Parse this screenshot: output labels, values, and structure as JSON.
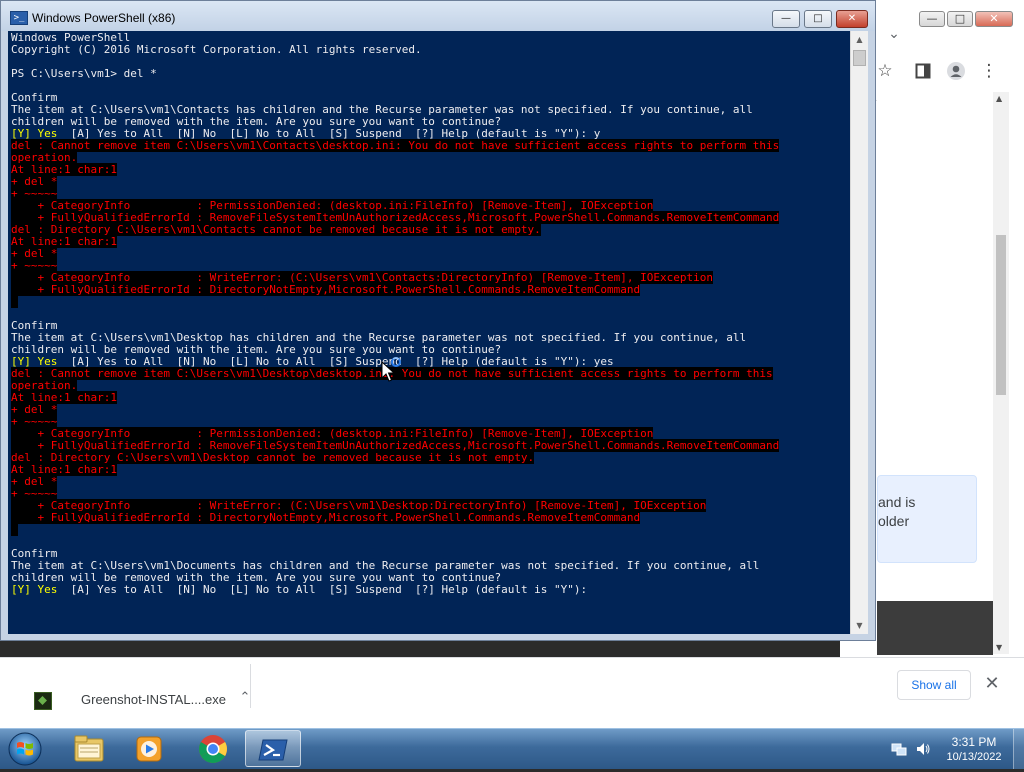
{
  "powershell": {
    "title": "Windows PowerShell (x86)",
    "icon_glyph": ">_",
    "buttons": {
      "minimize": "—",
      "maximize": "□",
      "close": "✕"
    },
    "lines": [
      {
        "t": "Windows PowerShell",
        "s": "normal"
      },
      {
        "t": "Copyright (C) 2016 Microsoft Corporation. All rights reserved.",
        "s": "normal"
      },
      {
        "t": "",
        "s": "normal"
      },
      {
        "t": "PS C:\\Users\\vm1> del *",
        "s": "normal"
      },
      {
        "t": "",
        "s": "normal"
      },
      {
        "t": "Confirm",
        "s": "normal"
      },
      {
        "t": "The item at C:\\Users\\vm1\\Contacts has children and the Recurse parameter was not specified. If you continue, all",
        "s": "normal"
      },
      {
        "t": "children will be removed with the item. Are you sure you want to continue?",
        "s": "normal"
      },
      {
        "t": "[Y] Yes  [A] Yes to All  [N] No  [L] No to All  [S] Suspend  [?] Help (default is \"Y\"): y",
        "s": "yes-prompt"
      },
      {
        "t": "del : Cannot remove item C:\\Users\\vm1\\Contacts\\desktop.ini: You do not have sufficient access rights to perform this",
        "s": "error"
      },
      {
        "t": "operation.",
        "s": "error"
      },
      {
        "t": "At line:1 char:1",
        "s": "error"
      },
      {
        "t": "+ del *",
        "s": "error"
      },
      {
        "t": "+ ~~~~~",
        "s": "error"
      },
      {
        "t": "    + CategoryInfo          : PermissionDenied: (desktop.ini:FileInfo) [Remove-Item], IOException",
        "s": "error"
      },
      {
        "t": "    + FullyQualifiedErrorId : RemoveFileSystemItemUnAuthorizedAccess,Microsoft.PowerShell.Commands.RemoveItemCommand",
        "s": "error"
      },
      {
        "t": "del : Directory C:\\Users\\vm1\\Contacts cannot be removed because it is not empty.",
        "s": "error"
      },
      {
        "t": "At line:1 char:1",
        "s": "error"
      },
      {
        "t": "+ del *",
        "s": "error"
      },
      {
        "t": "+ ~~~~~",
        "s": "error"
      },
      {
        "t": "    + CategoryInfo          : WriteError: (C:\\Users\\vm1\\Contacts:DirectoryInfo) [Remove-Item], IOException",
        "s": "error"
      },
      {
        "t": "    + FullyQualifiedErrorId : DirectoryNotEmpty,Microsoft.PowerShell.Commands.RemoveItemCommand",
        "s": "error"
      },
      {
        "t": " ",
        "s": "cursor"
      },
      {
        "t": "",
        "s": "normal"
      },
      {
        "t": "Confirm",
        "s": "normal"
      },
      {
        "t": "The item at C:\\Users\\vm1\\Desktop has children and the Recurse parameter was not specified. If you continue, all",
        "s": "normal"
      },
      {
        "t": "children will be removed with the item. Are you sure you want to continue?",
        "s": "normal"
      },
      {
        "t": "[Y] Yes  [A] Yes to All  [N] No  [L] No to All  [S] Suspend  [?] Help (default is \"Y\"): yes",
        "s": "yes-prompt"
      },
      {
        "t": "del : Cannot remove item C:\\Users\\vm1\\Desktop\\desktop.ini: You do not have sufficient access rights to perform this",
        "s": "error"
      },
      {
        "t": "operation.",
        "s": "error"
      },
      {
        "t": "At line:1 char:1",
        "s": "error"
      },
      {
        "t": "+ del *",
        "s": "error"
      },
      {
        "t": "+ ~~~~~",
        "s": "error"
      },
      {
        "t": "    + CategoryInfo          : PermissionDenied: (desktop.ini:FileInfo) [Remove-Item], IOException",
        "s": "error"
      },
      {
        "t": "    + FullyQualifiedErrorId : RemoveFileSystemItemUnAuthorizedAccess,Microsoft.PowerShell.Commands.RemoveItemCommand",
        "s": "error"
      },
      {
        "t": "del : Directory C:\\Users\\vm1\\Desktop cannot be removed because it is not empty.",
        "s": "error"
      },
      {
        "t": "At line:1 char:1",
        "s": "error"
      },
      {
        "t": "+ del *",
        "s": "error"
      },
      {
        "t": "+ ~~~~~",
        "s": "error"
      },
      {
        "t": "    + CategoryInfo          : WriteError: (C:\\Users\\vm1\\Desktop:DirectoryInfo) [Remove-Item], IOException",
        "s": "error"
      },
      {
        "t": "    + FullyQualifiedErrorId : DirectoryNotEmpty,Microsoft.PowerShell.Commands.RemoveItemCommand",
        "s": "error"
      },
      {
        "t": " ",
        "s": "cursor"
      },
      {
        "t": "",
        "s": "normal"
      },
      {
        "t": "Confirm",
        "s": "normal"
      },
      {
        "t": "The item at C:\\Users\\vm1\\Documents has children and the Recurse parameter was not specified. If you continue, all",
        "s": "normal"
      },
      {
        "t": "children will be removed with the item. Are you sure you want to continue?",
        "s": "normal"
      },
      {
        "t": "[Y] Yes  [A] Yes to All  [N] No  [L] No to All  [S] Suspend  [?] Help (default is \"Y\"):",
        "s": "yes-prompt"
      }
    ],
    "colors": {
      "background": "#012456",
      "text": "#eeedf0",
      "error_text": "#ff0000",
      "error_bg": "#000000",
      "prompt_yes": "#ffff00"
    }
  },
  "chrome": {
    "buttons": {
      "minimize": "—",
      "maximize": "□",
      "close": "✕"
    },
    "tab_dropdown_icon": "⌄",
    "toolbar_icons": [
      "star-icon",
      "sidepanel-icon",
      "profile-icon",
      "menu-icon"
    ],
    "toolbar_glyphs": {
      "star": "☆",
      "sidepanel": "▮",
      "profile": "●",
      "menu": "⋮"
    },
    "info_text_line1": "and is",
    "info_text_line2": "older",
    "download": {
      "filename": "Greenshot-INSTAL....exe",
      "chevron": "⌃",
      "show_all": "Show all",
      "close": "✕"
    }
  },
  "taskbar": {
    "apps": [
      "windows-explorer",
      "media-player",
      "chrome",
      "powershell"
    ],
    "active_app": "powershell",
    "clock": {
      "time": "3:31 PM",
      "date": "10/13/2022"
    },
    "tray_icons": [
      "network-icon",
      "volume-icon"
    ]
  }
}
